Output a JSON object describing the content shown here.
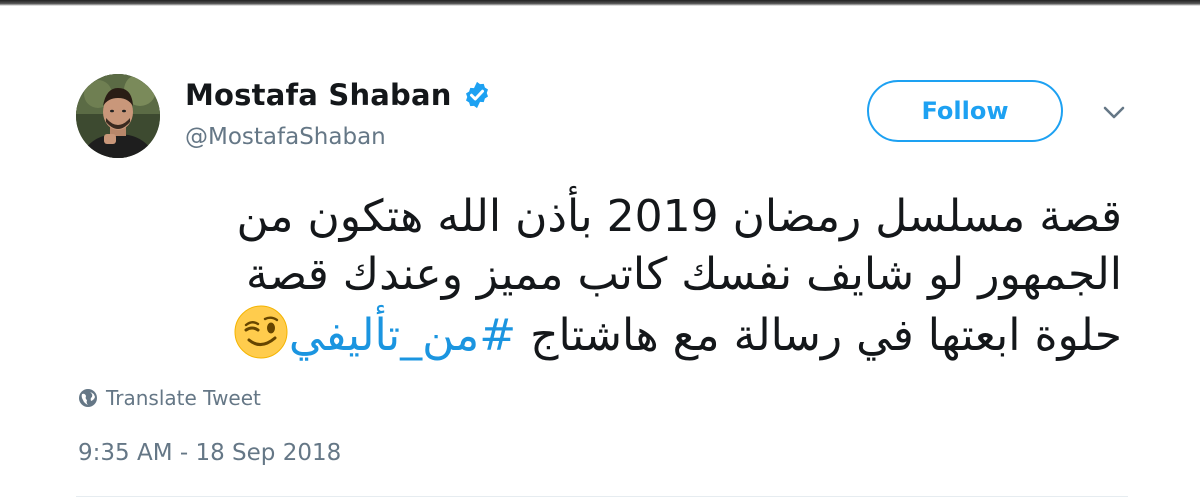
{
  "user": {
    "display_name": "Mostafa Shaban",
    "handle": "@MostafaShaban",
    "verified": true
  },
  "actions": {
    "follow_label": "Follow"
  },
  "tweet": {
    "lines": [
      "قصة مسلسل رمضان 2019 بأذن الله هتكون من",
      "الجمهور لو شايف نفسك كاتب مميز وعندك قصة",
      "حلوة ابعتها في رسالة مع هاشتاج"
    ],
    "hashtag": "#من_تأليفي",
    "emoji": "winking-face"
  },
  "translate_label": "Translate Tweet",
  "timestamp": "9:35 AM - 18 Sep 2018",
  "colors": {
    "accent": "#1da1f2",
    "hashtag": "#1b95e0",
    "secondary_text": "#657786",
    "primary_text": "#14171a"
  }
}
